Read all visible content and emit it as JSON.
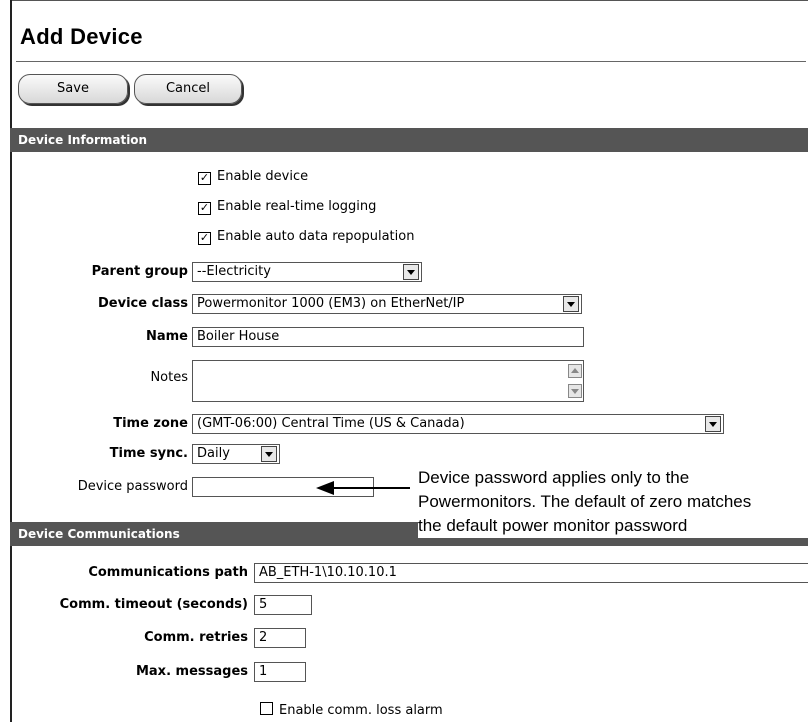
{
  "page": {
    "title": "Add Device"
  },
  "toolbar": {
    "save_label": "Save",
    "cancel_label": "Cancel"
  },
  "device_information": {
    "header": "Device Information",
    "checkboxes": [
      {
        "label": "Enable device",
        "checked": true
      },
      {
        "label": "Enable real-time logging",
        "checked": true
      },
      {
        "label": "Enable auto data repopulation",
        "checked": true
      }
    ],
    "parent_group": {
      "label": "Parent group",
      "value": "--Electricity"
    },
    "device_class": {
      "label": "Device class",
      "value": "Powermonitor 1000 (EM3) on EtherNet/IP"
    },
    "name": {
      "label": "Name",
      "value": "Boiler House"
    },
    "notes": {
      "label": "Notes",
      "value": ""
    },
    "time_zone": {
      "label": "Time zone",
      "value": "(GMT-06:00) Central Time (US & Canada)"
    },
    "time_sync": {
      "label": "Time sync.",
      "value": "Daily"
    },
    "device_password": {
      "label": "Device password",
      "value": ""
    }
  },
  "annotation": {
    "lines": [
      "Device password applies only to the",
      "Powermonitors. The default of zero matches",
      "the default power monitor password"
    ]
  },
  "device_communications": {
    "header": "Device Communications",
    "comm_path": {
      "label": "Communications path",
      "value": "AB_ETH-1\\10.10.10.1"
    },
    "comm_timeout": {
      "label": "Comm. timeout (seconds)",
      "value": "5"
    },
    "comm_retries": {
      "label": "Comm. retries",
      "value": "2"
    },
    "max_messages": {
      "label": "Max. messages",
      "value": "1"
    },
    "comm_loss_alarm": {
      "label": "Enable comm. loss alarm",
      "checked": false
    }
  }
}
